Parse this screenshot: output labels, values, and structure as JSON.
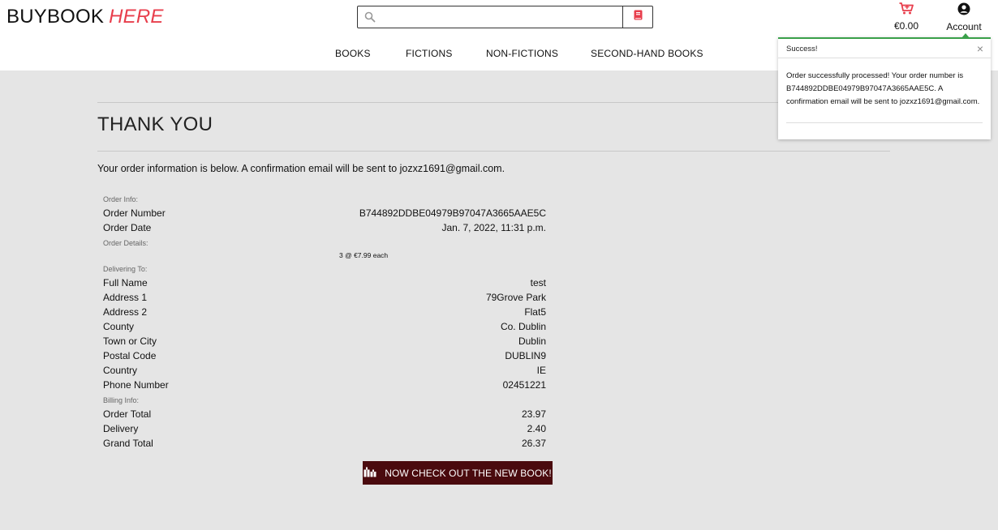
{
  "brand": {
    "name": "BUYBOOK",
    "accent": "HERE",
    "accent_color": "#e83e4c"
  },
  "search": {
    "placeholder": "",
    "value": ""
  },
  "header": {
    "cart_total": "€0.00",
    "account_label": "Account",
    "cart_icon_color": "#e83e4c"
  },
  "nav": {
    "items": [
      "BOOKS",
      "FICTIONS",
      "NON-FICTIONS",
      "SECOND-HAND BOOKS"
    ]
  },
  "page": {
    "title": "THANK YOU",
    "intro": "Your order information is below. A confirmation email will be sent to jozxz1691@gmail.com."
  },
  "order_info": {
    "section_label": "Order Info:",
    "rows": [
      {
        "label": "Order Number",
        "value": "B744892DDBE04979B97047A3665AAE5C"
      },
      {
        "label": "Order Date",
        "value": "Jan. 7, 2022, 11:31 p.m."
      }
    ]
  },
  "order_details": {
    "section_label": "Order Details:",
    "item_note": "3 @ €7.99 each"
  },
  "delivering": {
    "section_label": "Delivering To:",
    "rows": [
      {
        "label": "Full Name",
        "value": "test"
      },
      {
        "label": "Address 1",
        "value": "79Grove Park"
      },
      {
        "label": "Address 2",
        "value": "Flat5"
      },
      {
        "label": "County",
        "value": "Co. Dublin"
      },
      {
        "label": "Town or City",
        "value": "Dublin"
      },
      {
        "label": "Postal Code",
        "value": "DUBLIN9"
      },
      {
        "label": "Country",
        "value": "IE"
      },
      {
        "label": "Phone Number",
        "value": "02451221"
      }
    ]
  },
  "billing": {
    "section_label": "Billing Info:",
    "rows": [
      {
        "label": "Order Total",
        "value": "23.97"
      },
      {
        "label": "Delivery",
        "value": "2.40"
      },
      {
        "label": "Grand Total",
        "value": "26.37"
      }
    ]
  },
  "cta": {
    "label": "NOW CHECK OUT THE NEW BOOK!",
    "color": "#4a0a0e"
  },
  "toast": {
    "title": "Success!",
    "close": "×",
    "message": "Order successfully processed! Your order number is B744892DDBE04979B97047A3665AAE5C. A confirmation email will be sent to jozxz1691@gmail.com.",
    "border_color": "#3aa04a"
  }
}
